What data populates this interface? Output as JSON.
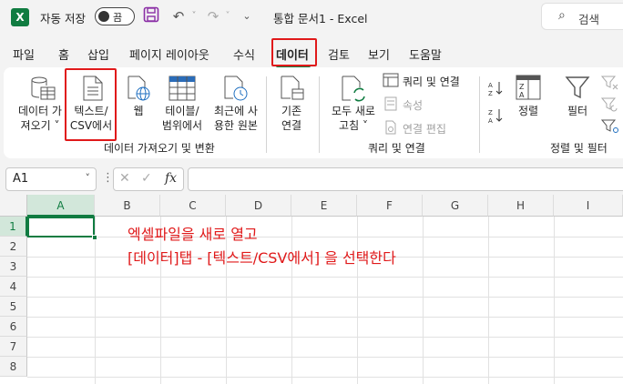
{
  "titlebar": {
    "logo_letter": "X",
    "autosave_label": "자동 저장",
    "autosave_state": "끔",
    "title": "통합 문서1  -  Excel",
    "search_label": "검색"
  },
  "tabs": [
    {
      "label": "파일"
    },
    {
      "label": "홈"
    },
    {
      "label": "삽입"
    },
    {
      "label": "페이지 레이아웃"
    },
    {
      "label": "수식"
    },
    {
      "label": "데이터"
    },
    {
      "label": "검토"
    },
    {
      "label": "보기"
    },
    {
      "label": "도움말"
    }
  ],
  "ribbon": {
    "get_data_line1": "데이터 가",
    "get_data_line2": "져오기 ˅",
    "text_csv_line1": "텍스트/",
    "text_csv_line2": "CSV에서",
    "web": "웹",
    "table_line1": "테이블/",
    "table_line2": "범위에서",
    "recent_line1": "최근에 사",
    "recent_line2": "용한 원본",
    "existing_line1": "기존",
    "existing_line2": "연결",
    "group_get_transform": "데이터 가져오기 및 변환",
    "refresh_line1": "모두 새로",
    "refresh_line2": "고침 ˅",
    "queries_connections": "쿼리 및 연결",
    "properties": "속성",
    "edit_links": "연결 편집",
    "group_queries": "쿼리 및 연결",
    "sort": "정렬",
    "filter": "필터",
    "group_sort_filter": "정렬 및 필터"
  },
  "formula_bar": {
    "name_box": "A1",
    "fx": "fx",
    "formula": ""
  },
  "sheet": {
    "columns": [
      "A",
      "B",
      "C",
      "D",
      "E",
      "F",
      "G",
      "H",
      "I"
    ],
    "rows": [
      "1",
      "2",
      "3",
      "4",
      "5",
      "6",
      "7",
      "8"
    ],
    "annotation_line1": "엑셀파일을 새로 열고",
    "annotation_line2": "[데이터]탭 - [텍스트/CSV에서] 을 선택한다"
  }
}
